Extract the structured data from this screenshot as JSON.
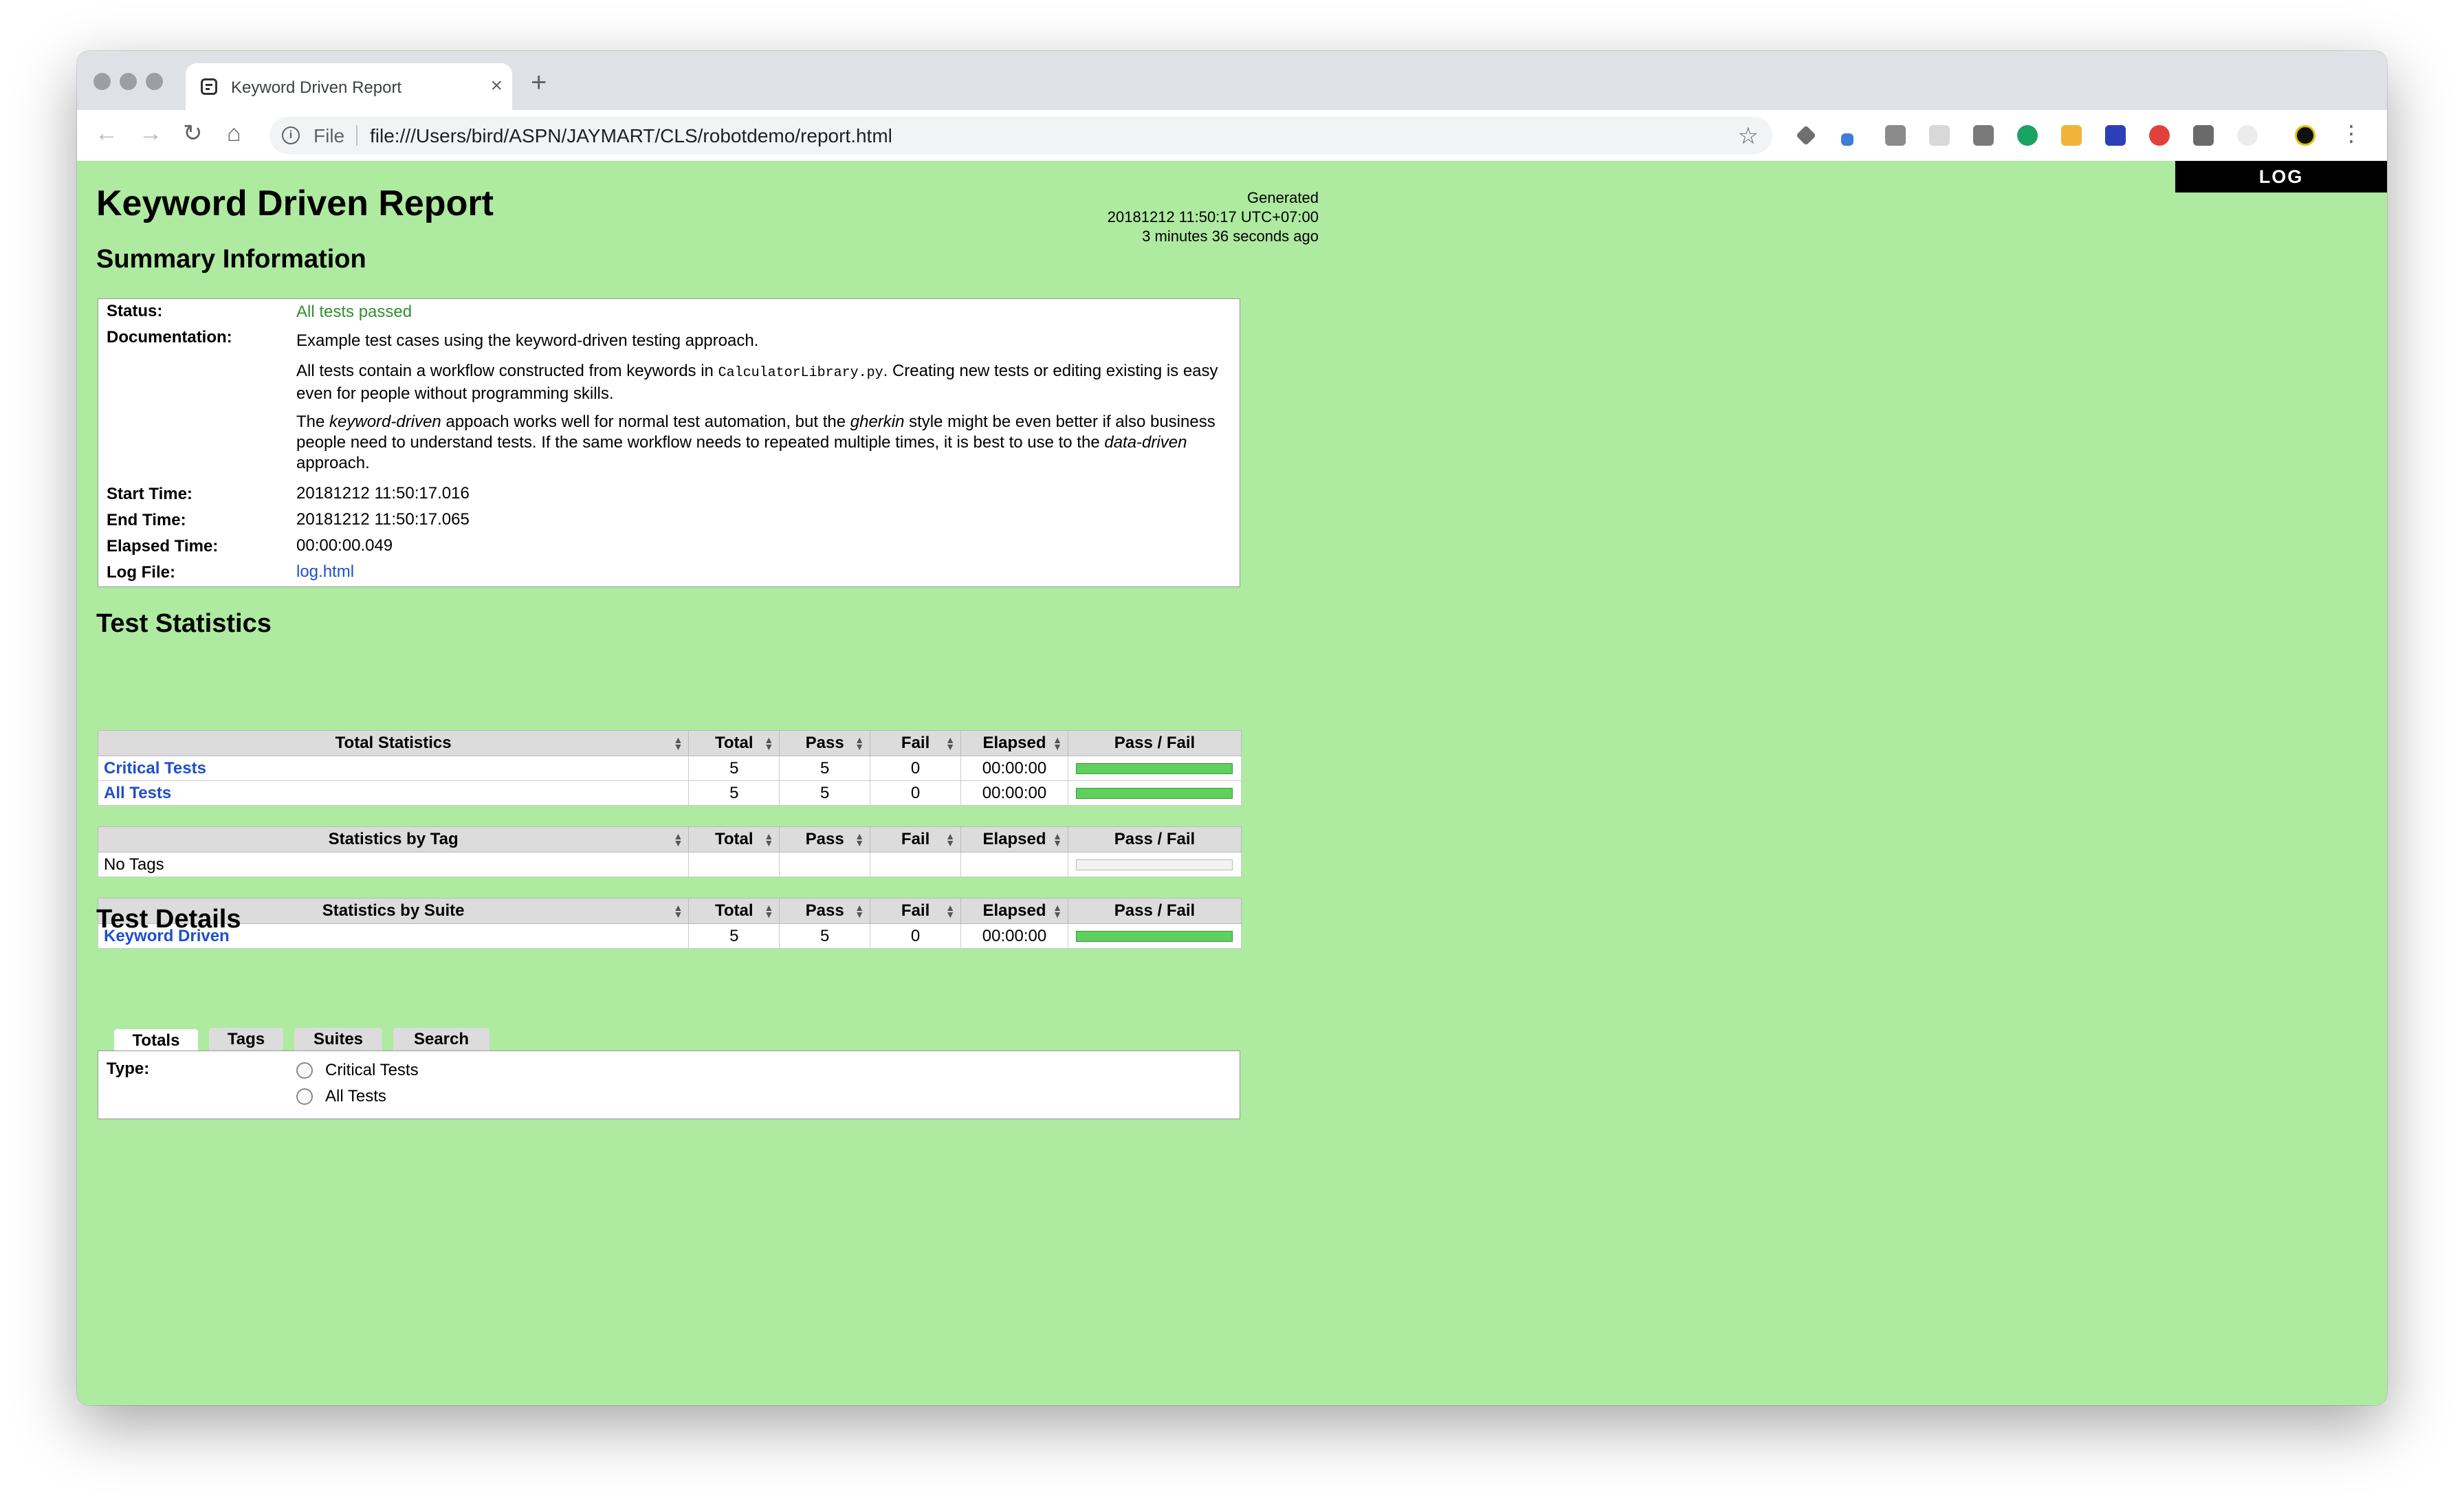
{
  "browser": {
    "tab_title": "Keyword Driven Report",
    "tab_close": "×",
    "new_tab": "+",
    "file_label": "File",
    "url": "file:///Users/bird/ASPN/JAYMART/CLS/robotdemo/report.html",
    "back": "←",
    "forward": "→",
    "reload": "↻",
    "home": "⌂",
    "star": "☆",
    "menu": "⋮"
  },
  "report": {
    "log_button": "LOG",
    "title": "Keyword Driven Report",
    "generated_label": "Generated",
    "generated_time": "20181212 11:50:17 UTC+07:00",
    "generated_ago": "3 minutes 36 seconds ago",
    "summary_heading": "Summary Information",
    "summary": {
      "status_label": "Status:",
      "status_value": "All tests passed",
      "documentation_label": "Documentation:",
      "doc_p1": "Example test cases using the keyword-driven testing approach.",
      "doc_p2_a": "All tests contain a workflow constructed from keywords in ",
      "doc_p2_code": "CalculatorLibrary.py",
      "doc_p2_b": ". Creating new tests or editing existing is easy even for people without programming skills.",
      "doc_p3_a": "The ",
      "doc_p3_em1": "keyword-driven",
      "doc_p3_b": " appoach works well for normal test automation, but the ",
      "doc_p3_em2": "gherkin",
      "doc_p3_c": " style might be even better if also business people need to understand tests. If the same workflow needs to repeated multiple times, it is best to use to the ",
      "doc_p3_em3": "data-driven",
      "doc_p3_d": " approach.",
      "start_label": "Start Time:",
      "start_value": "20181212 11:50:17.016",
      "end_label": "End Time:",
      "end_value": "20181212 11:50:17.065",
      "elapsed_label": "Elapsed Time:",
      "elapsed_value": "00:00:00.049",
      "logfile_label": "Log File:",
      "logfile_value": "log.html"
    },
    "stats_heading": "Test Statistics",
    "columns": {
      "total": "Total",
      "pass": "Pass",
      "fail": "Fail",
      "elapsed": "Elapsed",
      "passfail": "Pass / Fail"
    },
    "total_stats": {
      "header": "Total Statistics",
      "rows": [
        {
          "name": "Critical Tests",
          "total": "5",
          "pass": "5",
          "fail": "0",
          "elapsed": "00:00:00",
          "pass_fraction": 1.0
        },
        {
          "name": "All Tests",
          "total": "5",
          "pass": "5",
          "fail": "0",
          "elapsed": "00:00:00",
          "pass_fraction": 1.0
        }
      ]
    },
    "tag_stats": {
      "header": "Statistics by Tag",
      "rows": [
        {
          "name": "No Tags",
          "total": "",
          "pass": "",
          "fail": "",
          "elapsed": "",
          "pass_fraction": 0
        }
      ]
    },
    "suite_stats": {
      "header": "Statistics by Suite",
      "rows": [
        {
          "name": "Keyword Driven",
          "total": "5",
          "pass": "5",
          "fail": "0",
          "elapsed": "00:00:00",
          "pass_fraction": 1.0
        }
      ]
    },
    "details_heading": "Test Details",
    "detail_tabs": [
      "Totals",
      "Tags",
      "Suites",
      "Search"
    ],
    "type_label": "Type:",
    "type_options": [
      "Critical Tests",
      "All Tests"
    ]
  }
}
